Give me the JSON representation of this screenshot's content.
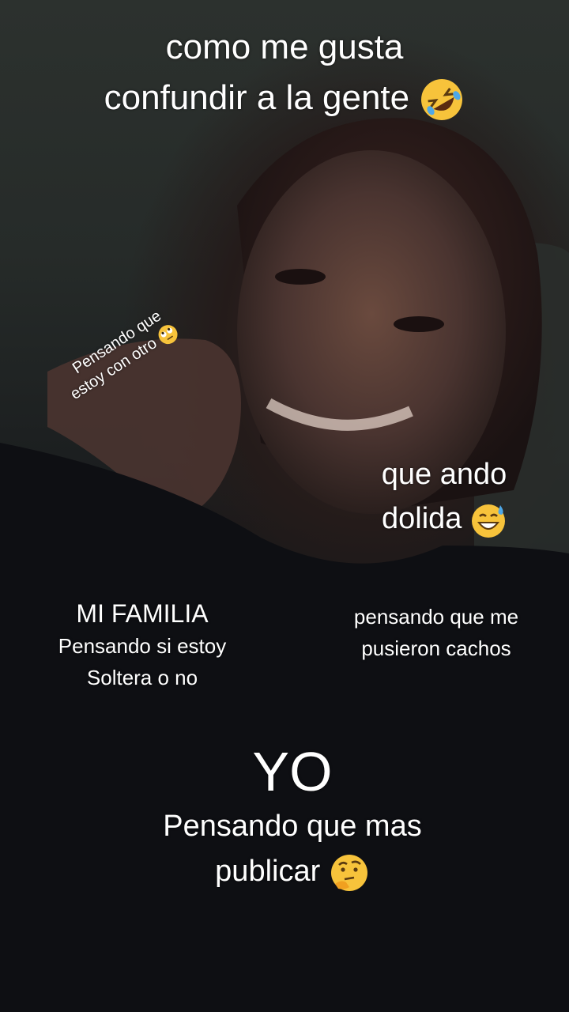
{
  "captions": {
    "top_line1": "como me  gusta",
    "top_line2": "confundir a la gente",
    "top_emoji": "rolling-on-floor-laughing-emoji",
    "tilted_line1": "Pensando que",
    "tilted_line2": "estoy con otro",
    "tilted_emoji": "face-with-rolling-eyes-emoji",
    "right_line1": "que ando",
    "right_line2": "dolida",
    "right_emoji": "grinning-face-with-sweat-emoji",
    "family_title": "MI FAMILIA",
    "family_line1": "Pensando si estoy",
    "family_line2": "Soltera o no",
    "cachos_line1": "pensando que me",
    "cachos_line2": "pusieron cachos",
    "yo_title": "YO",
    "yo_line1": "Pensando que mas",
    "yo_line2": "publicar",
    "yo_emoji": "thinking-face-emoji"
  },
  "colors": {
    "text": "#ffffff",
    "emoji_yellow": "#f7c33b"
  }
}
